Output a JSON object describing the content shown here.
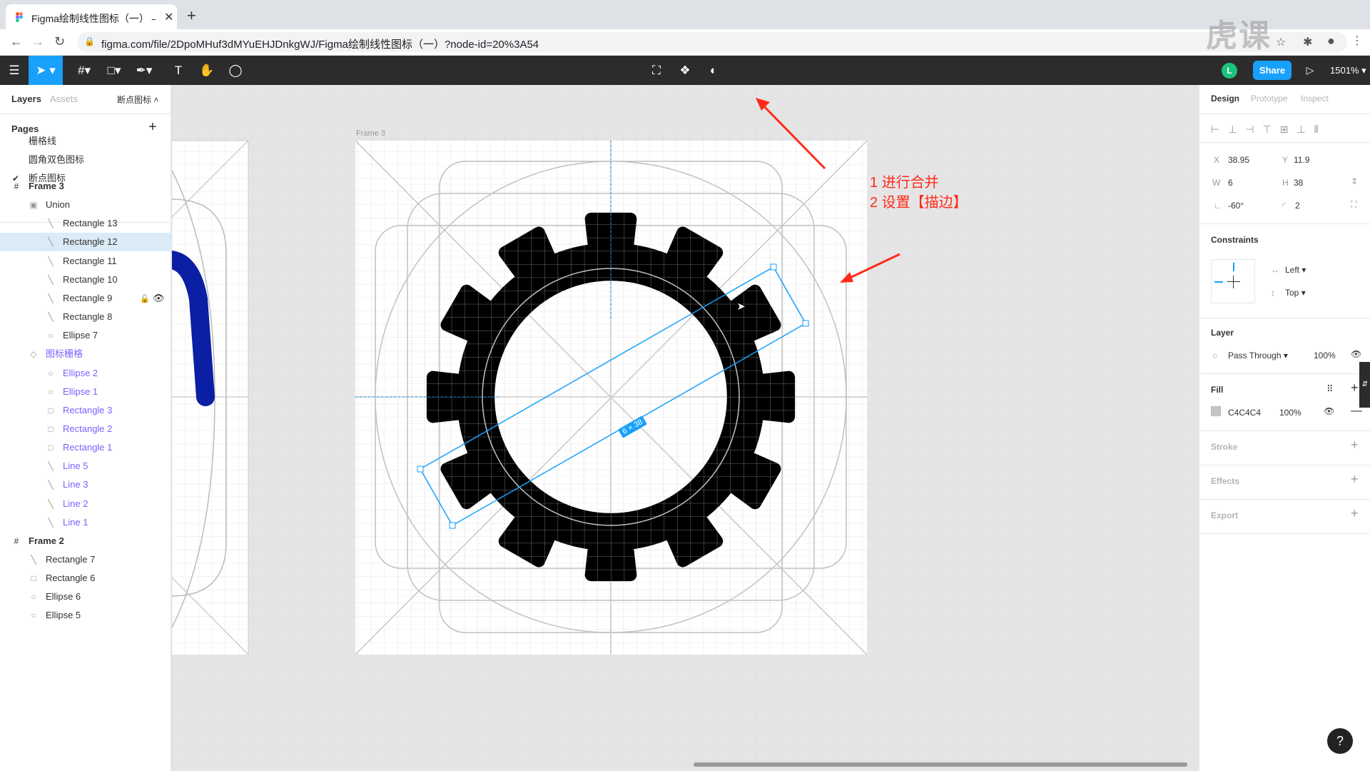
{
  "browser": {
    "tab_title": "Figma绘制线性图标（一） – Fig",
    "url": "figma.com/file/2DpoMHuf3dMYuEHJDnkgWJ/Figma绘制线性图标（一）?node-id=20%3A54"
  },
  "toolbar": {
    "share_label": "Share",
    "avatar_initial": "L",
    "zoom": "1501%"
  },
  "left_panel": {
    "tabs": {
      "layers": "Layers",
      "assets": "Assets",
      "page_dropdown": "断点图标"
    },
    "pages_title": "Pages",
    "pages": [
      "栅格线",
      "圆角双色图标",
      "断点图标"
    ],
    "layers": [
      {
        "name": "Frame 3",
        "icon": "frame-icon"
      },
      {
        "name": "Union",
        "icon": "union-icon"
      },
      {
        "name": "Rectangle 13",
        "icon": "line-icon"
      },
      {
        "name": "Rectangle 12",
        "icon": "line-icon"
      },
      {
        "name": "Rectangle 11",
        "icon": "line-icon"
      },
      {
        "name": "Rectangle 10",
        "icon": "line-icon"
      },
      {
        "name": "Rectangle 9",
        "icon": "line-icon"
      },
      {
        "name": "Rectangle 8",
        "icon": "line-icon"
      },
      {
        "name": "Ellipse 7",
        "icon": "ellipse-icon"
      },
      {
        "name": "图标栅格",
        "icon": "component-icon"
      },
      {
        "name": "Ellipse 2",
        "icon": "ellipse-icon"
      },
      {
        "name": "Ellipse 1",
        "icon": "ellipse-icon"
      },
      {
        "name": "Rectangle 3",
        "icon": "rect-icon"
      },
      {
        "name": "Rectangle 2",
        "icon": "rect-icon"
      },
      {
        "name": "Rectangle 1",
        "icon": "rect-icon"
      },
      {
        "name": "Line 5",
        "icon": "line-icon"
      },
      {
        "name": "Line 3",
        "icon": "line-icon"
      },
      {
        "name": "Line 2",
        "icon": "line-icon"
      },
      {
        "name": "Line 1",
        "icon": "line-icon"
      },
      {
        "name": "Frame 2",
        "icon": "frame-icon"
      },
      {
        "name": "Rectangle 7",
        "icon": "line-icon"
      },
      {
        "name": "Rectangle 6",
        "icon": "rect-icon"
      },
      {
        "name": "Ellipse 6",
        "icon": "ellipse-icon"
      },
      {
        "name": "Ellipse 5",
        "icon": "ellipse-icon"
      }
    ]
  },
  "right_panel": {
    "tabs": {
      "design": "Design",
      "prototype": "Prototype",
      "inspect": "Inspect"
    },
    "x_label": "X",
    "x": "38.95",
    "y_label": "Y",
    "y": "11.9",
    "w_label": "W",
    "w": "6",
    "h_label": "H",
    "h": "38",
    "rotation": "-60°",
    "radius": "2",
    "constraints_title": "Constraints",
    "constraint_h": "Left",
    "constraint_v": "Top",
    "layer_title": "Layer",
    "blend": "Pass Through",
    "opacity": "100%",
    "fill_title": "Fill",
    "fill_hex": "C4C4C4",
    "fill_opacity": "100%",
    "fill_color": "#c4c4c4",
    "stroke_title": "Stroke",
    "effects_title": "Effects",
    "export_title": "Export"
  },
  "canvas": {
    "frame_label": "Frame 3",
    "size_badge": "6 × 38",
    "annotation_line1": "1 进行合并",
    "annotation_line2": "2 设置【描边】",
    "accent": "#18a0fb",
    "annotation_color": "#ff2a1a"
  }
}
